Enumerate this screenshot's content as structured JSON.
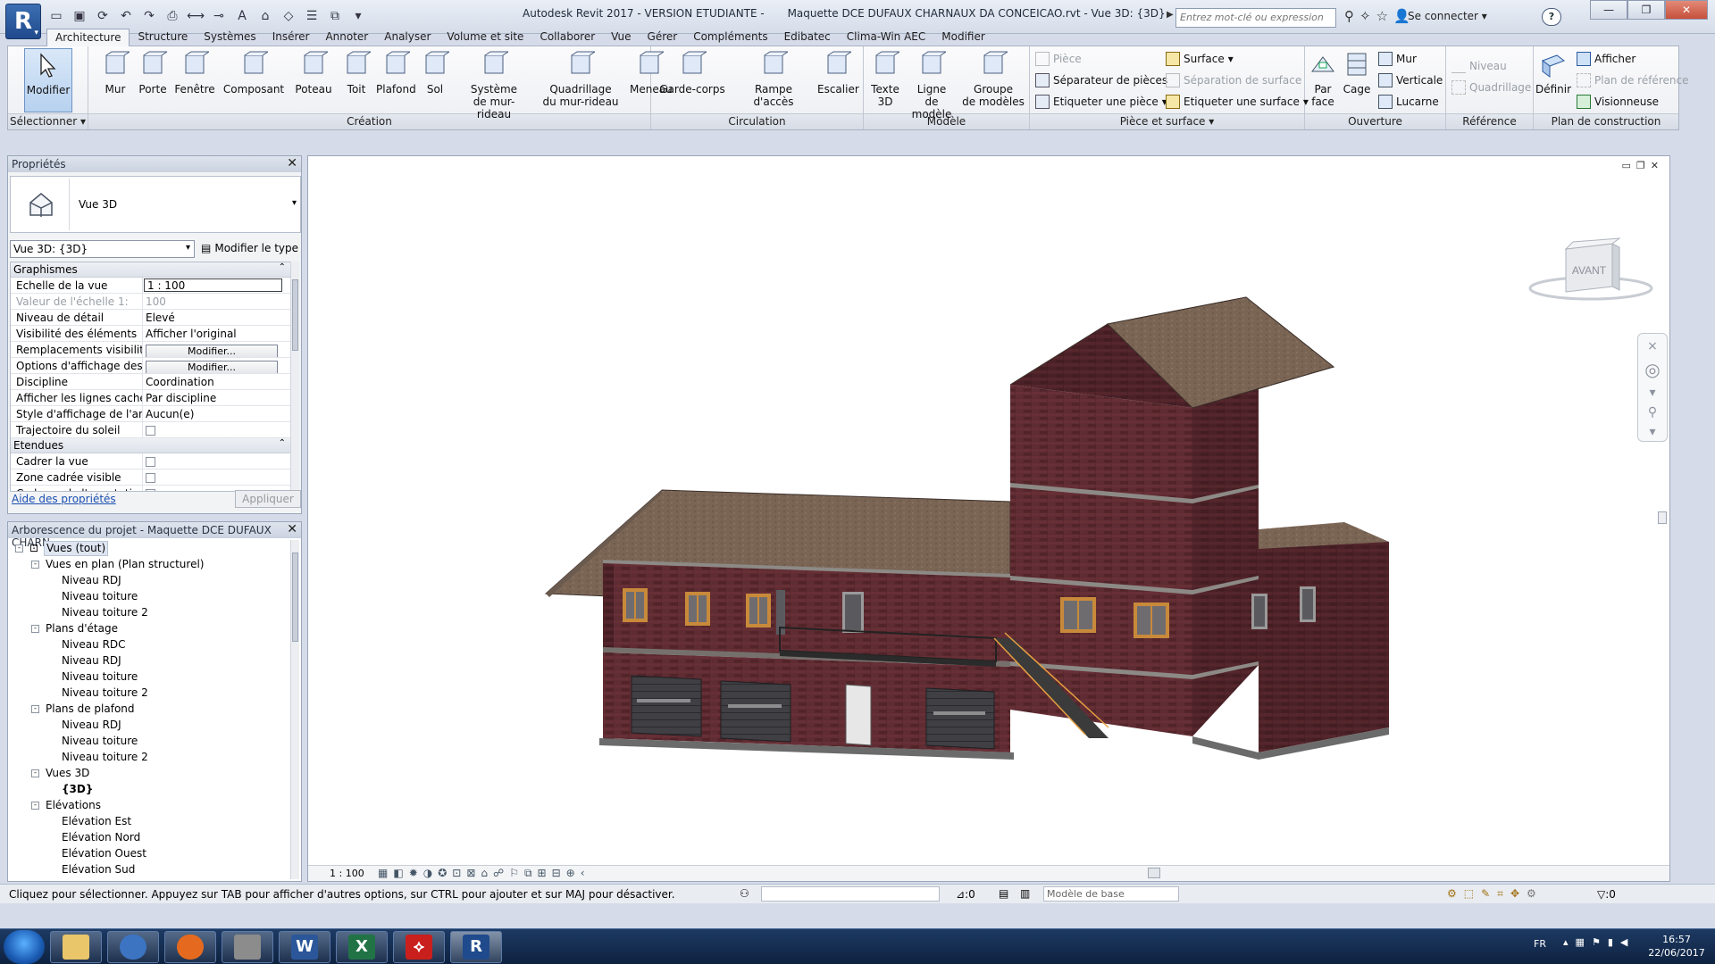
{
  "window": {
    "app_title": "Autodesk Revit 2017 - VERSION ETUDIANTE -",
    "document_title": "Maquette DCE DUFAUX CHARNAUX DA CONCEICAO.rvt - Vue 3D: {3D}",
    "logo_letter": "R",
    "search_placeholder": "Entrez mot-clé ou expression",
    "sign_in": "Se connecter",
    "help": "?"
  },
  "ribbon_tabs": [
    "Architecture",
    "Structure",
    "Systèmes",
    "Insérer",
    "Annoter",
    "Analyser",
    "Volume et site",
    "Collaborer",
    "Vue",
    "Gérer",
    "Compléments",
    "Edibatec",
    "Clima-Win AEC",
    "Modifier"
  ],
  "ribbon": {
    "select": {
      "button": "Modifier",
      "label": "Sélectionner"
    },
    "creation": {
      "label": "Création",
      "buttons": [
        "Mur",
        "Porte",
        "Fenêtre",
        "Composant",
        "Poteau",
        "Toit",
        "Plafond",
        "Sol",
        "Système\nde mur-rideau",
        "Quadrillage\ndu mur-rideau",
        "Meneau"
      ]
    },
    "circulation": {
      "label": "Circulation",
      "buttons": [
        "Garde-corps",
        "Rampe d'accès",
        "Escalier"
      ]
    },
    "modele": {
      "label": "Modèle",
      "buttons": [
        "Texte\n3D",
        "Ligne\nde modèle",
        "Groupe\nde modèles"
      ]
    },
    "piece": {
      "label": "Pièce et surface",
      "items": [
        "Pièce",
        "Séparateur de pièces",
        "Etiqueter une pièce",
        "Surface",
        "Séparation de surface",
        "Etiqueter une surface"
      ]
    },
    "ouverture": {
      "label": "Ouverture",
      "big": [
        "Par\nface",
        "Cage"
      ],
      "small": [
        "Mur",
        "Verticale",
        "Lucarne"
      ]
    },
    "reference": {
      "label": "Référence",
      "items": [
        "Niveau",
        "Quadrillage"
      ]
    },
    "plan_construction": {
      "label": "Plan de construction",
      "big": "Définir",
      "small": [
        "Afficher",
        "Plan de référence",
        "Visionneuse"
      ]
    }
  },
  "properties": {
    "title": "Propriétés",
    "type_name": "Vue 3D",
    "instance": "Vue 3D: {3D}",
    "edit_type": "Modifier le type",
    "groups": [
      {
        "name": "Graphismes",
        "rows": [
          {
            "name": "Echelle de la vue",
            "value": "1 : 100",
            "kind": "edit"
          },
          {
            "name": "Valeur de l'échelle   1:",
            "value": "100",
            "kind": "dim"
          },
          {
            "name": "Niveau de détail",
            "value": "Elevé",
            "kind": "text"
          },
          {
            "name": "Visibilité des éléments",
            "value": "Afficher l'original",
            "kind": "text"
          },
          {
            "name": "Remplacements visibilit...",
            "value": "Modifier...",
            "kind": "button"
          },
          {
            "name": "Options d'affichage des ...",
            "value": "Modifier...",
            "kind": "button"
          },
          {
            "name": "Discipline",
            "value": "Coordination",
            "kind": "text"
          },
          {
            "name": "Afficher les lignes cachées",
            "value": "Par discipline",
            "kind": "text"
          },
          {
            "name": "Style d'affichage de l'an...",
            "value": "Aucun(e)",
            "kind": "text"
          },
          {
            "name": "Trajectoire du soleil",
            "value": "",
            "kind": "check"
          }
        ]
      },
      {
        "name": "Etendues",
        "rows": [
          {
            "name": "Cadrer la vue",
            "value": "",
            "kind": "check"
          },
          {
            "name": "Zone cadrée visible",
            "value": "",
            "kind": "check"
          },
          {
            "name": "Cadrage de l'annotation",
            "value": "",
            "kind": "check"
          }
        ]
      }
    ],
    "help_link": "Aide des propriétés",
    "apply": "Appliquer"
  },
  "browser": {
    "title": "Arborescence du projet - Maquette DCE DUFAUX CHARN...",
    "tree": [
      {
        "level": 0,
        "label": "Vues (tout)",
        "toggle": "-"
      },
      {
        "level": 1,
        "label": "Vues en plan (Plan structurel)",
        "toggle": "-"
      },
      {
        "level": 2,
        "label": "Niveau RDJ"
      },
      {
        "level": 2,
        "label": "Niveau toiture"
      },
      {
        "level": 2,
        "label": "Niveau toiture 2"
      },
      {
        "level": 1,
        "label": "Plans d'étage",
        "toggle": "-"
      },
      {
        "level": 2,
        "label": "Niveau RDC"
      },
      {
        "level": 2,
        "label": "Niveau RDJ"
      },
      {
        "level": 2,
        "label": "Niveau toiture"
      },
      {
        "level": 2,
        "label": "Niveau toiture 2"
      },
      {
        "level": 1,
        "label": "Plans de plafond",
        "toggle": "-"
      },
      {
        "level": 2,
        "label": "Niveau RDJ"
      },
      {
        "level": 2,
        "label": "Niveau toiture"
      },
      {
        "level": 2,
        "label": "Niveau toiture 2"
      },
      {
        "level": 1,
        "label": "Vues 3D",
        "toggle": "-"
      },
      {
        "level": 2,
        "label": "{3D}",
        "bold": true
      },
      {
        "level": 1,
        "label": "Elévations",
        "toggle": "-"
      },
      {
        "level": 2,
        "label": "Elévation Est"
      },
      {
        "level": 2,
        "label": "Elévation Nord"
      },
      {
        "level": 2,
        "label": "Elévation Ouest"
      },
      {
        "level": 2,
        "label": "Elévation Sud"
      }
    ]
  },
  "viewport": {
    "viewcube_label": "AVANT",
    "scale": "1 : 100"
  },
  "status": {
    "message": "Cliquez pour sélectionner. Appuyez sur TAB pour afficher d'autres options, sur CTRL pour ajouter et sur MAJ pour désactiver.",
    "count1": ":0",
    "model": "Modèle de base",
    "count2": ":0"
  },
  "taskbar": {
    "lang": "FR",
    "time": "16:57",
    "date": "22/06/2017",
    "apps": [
      "explorer",
      "sketchup",
      "firefox",
      "revit-viewer",
      "word",
      "excel",
      "acrobat",
      "revit"
    ]
  },
  "colors": {
    "brick": "#5a2a2e",
    "roof": "#7a6656",
    "accent": "#1f4a8c"
  }
}
